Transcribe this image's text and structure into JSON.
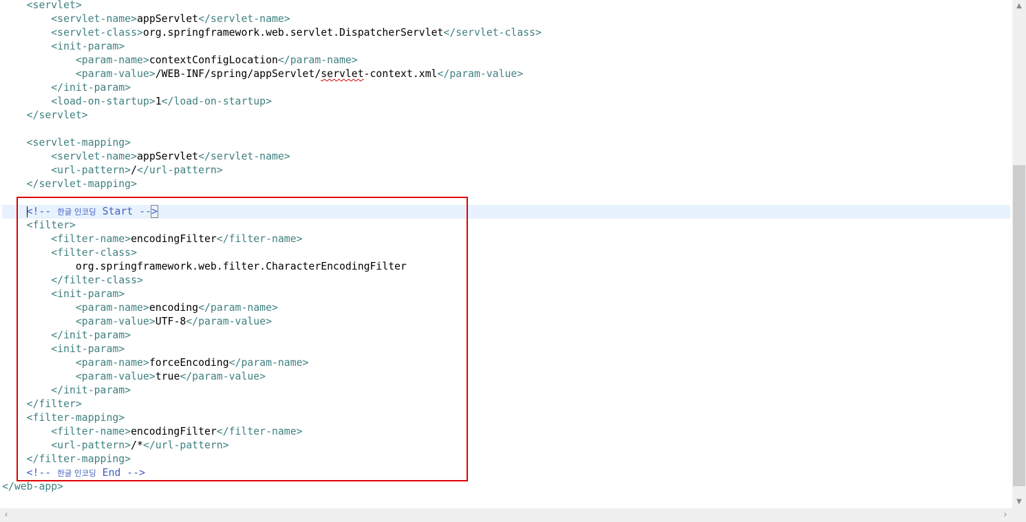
{
  "editor": {
    "current_line_index": 15,
    "lines": [
      [
        {
          "t": "tag",
          "v": "    <servlet>"
        }
      ],
      [
        {
          "t": "tag",
          "v": "        <servlet-name>"
        },
        {
          "t": "text",
          "v": "appServlet"
        },
        {
          "t": "tag",
          "v": "</servlet-name>"
        }
      ],
      [
        {
          "t": "tag",
          "v": "        <servlet-class>"
        },
        {
          "t": "text",
          "v": "org.springframework.web.servlet.DispatcherServlet"
        },
        {
          "t": "tag",
          "v": "</servlet-class>"
        }
      ],
      [
        {
          "t": "tag",
          "v": "        <init-param>"
        }
      ],
      [
        {
          "t": "tag",
          "v": "            <param-name>"
        },
        {
          "t": "text",
          "v": "contextConfigLocation"
        },
        {
          "t": "tag",
          "v": "</param-name>"
        }
      ],
      [
        {
          "t": "tag",
          "v": "            <param-value>"
        },
        {
          "t": "text",
          "v": "/WEB-INF/spring/appServlet/"
        },
        {
          "t": "squiggle",
          "v": "servlet"
        },
        {
          "t": "text",
          "v": "-context.xml"
        },
        {
          "t": "tag",
          "v": "</param-value>"
        }
      ],
      [
        {
          "t": "tag",
          "v": "        </init-param>"
        }
      ],
      [
        {
          "t": "tag",
          "v": "        <load-on-startup>"
        },
        {
          "t": "text",
          "v": "1"
        },
        {
          "t": "tag",
          "v": "</load-on-startup>"
        }
      ],
      [
        {
          "t": "tag",
          "v": "    </servlet>"
        }
      ],
      [],
      [
        {
          "t": "tag",
          "v": "    <servlet-mapping>"
        }
      ],
      [
        {
          "t": "tag",
          "v": "        <servlet-name>"
        },
        {
          "t": "text",
          "v": "appServlet"
        },
        {
          "t": "tag",
          "v": "</servlet-name>"
        }
      ],
      [
        {
          "t": "tag",
          "v": "        <url-pattern>"
        },
        {
          "t": "text",
          "v": "/"
        },
        {
          "t": "tag",
          "v": "</url-pattern>"
        }
      ],
      [
        {
          "t": "tag",
          "v": "    </servlet-mapping>"
        }
      ],
      [],
      [
        {
          "t": "comment-caret",
          "v": "    "
        },
        {
          "t": "comment",
          "v": "<!-- "
        },
        {
          "t": "comment-kr",
          "v": "한글 인코딩"
        },
        {
          "t": "comment",
          "v": " Start --"
        },
        {
          "t": "comment-box",
          "v": ">"
        }
      ],
      [
        {
          "t": "tag",
          "v": "    <filter>"
        }
      ],
      [
        {
          "t": "tag",
          "v": "        <filter-name>"
        },
        {
          "t": "text",
          "v": "encodingFilter"
        },
        {
          "t": "tag",
          "v": "</filter-name>"
        }
      ],
      [
        {
          "t": "tag",
          "v": "        <filter-class>"
        }
      ],
      [
        {
          "t": "text",
          "v": "            org.springframework.web.filter.CharacterEncodingFilter"
        }
      ],
      [
        {
          "t": "tag",
          "v": "        </filter-class>"
        }
      ],
      [
        {
          "t": "tag",
          "v": "        <init-param>"
        }
      ],
      [
        {
          "t": "tag",
          "v": "            <param-name>"
        },
        {
          "t": "text",
          "v": "encoding"
        },
        {
          "t": "tag",
          "v": "</param-name>"
        }
      ],
      [
        {
          "t": "tag",
          "v": "            <param-value>"
        },
        {
          "t": "text",
          "v": "UTF-8"
        },
        {
          "t": "tag",
          "v": "</param-value>"
        }
      ],
      [
        {
          "t": "tag",
          "v": "        </init-param>"
        }
      ],
      [
        {
          "t": "tag",
          "v": "        <init-param>"
        }
      ],
      [
        {
          "t": "tag",
          "v": "            <param-name>"
        },
        {
          "t": "text",
          "v": "forceEncoding"
        },
        {
          "t": "tag",
          "v": "</param-name>"
        }
      ],
      [
        {
          "t": "tag",
          "v": "            <param-value>"
        },
        {
          "t": "text",
          "v": "true"
        },
        {
          "t": "tag",
          "v": "</param-value>"
        }
      ],
      [
        {
          "t": "tag",
          "v": "        </init-param>"
        }
      ],
      [
        {
          "t": "tag",
          "v": "    </filter>"
        }
      ],
      [
        {
          "t": "tag",
          "v": "    <filter-mapping>"
        }
      ],
      [
        {
          "t": "tag",
          "v": "        <filter-name>"
        },
        {
          "t": "text",
          "v": "encodingFilter"
        },
        {
          "t": "tag",
          "v": "</filter-name>"
        }
      ],
      [
        {
          "t": "tag",
          "v": "        <url-pattern>"
        },
        {
          "t": "text",
          "v": "/*"
        },
        {
          "t": "tag",
          "v": "</url-pattern>"
        }
      ],
      [
        {
          "t": "tag",
          "v": "    </filter-mapping>"
        }
      ],
      [
        {
          "t": "comment",
          "v": "    <!-- "
        },
        {
          "t": "comment-kr",
          "v": "한글 인코딩"
        },
        {
          "t": "comment",
          "v": " End -->"
        }
      ],
      [
        {
          "t": "tag",
          "v": "</web-app>"
        }
      ]
    ]
  },
  "colors": {
    "xml_tag": "#3f7f7f",
    "text": "#000000",
    "comment": "#3f5fbf",
    "current_line": "#e8f2fe",
    "highlight_box": "#e00000",
    "spelling_squiggle": "#d00000"
  },
  "icons": {
    "scroll_up": "▲",
    "scroll_down": "▼",
    "scroll_left": "‹",
    "scroll_right": "›"
  }
}
